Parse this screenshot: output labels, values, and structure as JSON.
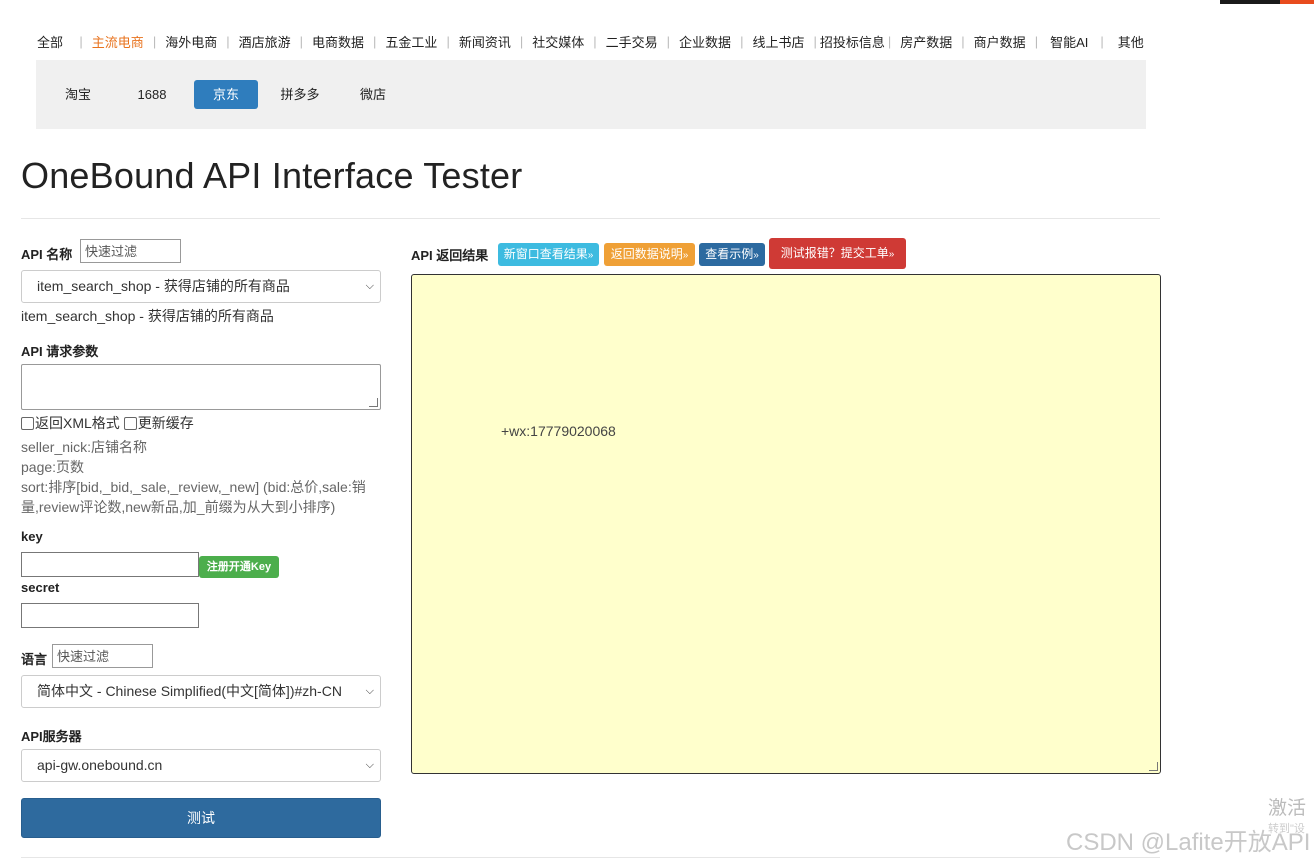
{
  "nav": {
    "items": [
      "全部",
      "主流电商",
      "海外电商",
      "酒店旅游",
      "电商数据",
      "五金工业",
      "新闻资讯",
      "社交媒体",
      "二手交易",
      "企业数据",
      "线上书店",
      "招投标信息",
      "房产数据",
      "商户数据",
      "智能AI",
      "其他"
    ],
    "active": "主流电商"
  },
  "subnav": {
    "items": [
      "淘宝",
      "1688",
      "京东",
      "拼多多",
      "微店"
    ],
    "active": "京东"
  },
  "page_title": "OneBound API Interface Tester",
  "form": {
    "api_name_label": "API 名称",
    "api_filter_placeholder": "快速过滤",
    "api_select_value": "item_search_shop - 获得店铺的所有商品",
    "api_desc": "item_search_shop - 获得店铺的所有商品",
    "params_label": "API 请求参数",
    "xml_check_label": "返回XML格式",
    "cache_check_label": "更新缓存",
    "hint_lines": [
      "seller_nick:店铺名称",
      "page:页数",
      "sort:排序[bid,_bid,_sale,_review,_new] (bid:总价,sale:销",
      "量,review评论数,new新品,加_前缀为从大到小排序)"
    ],
    "key_label": "key",
    "register_button": "注册开通Key",
    "secret_label": "secret",
    "lang_label": "语言",
    "lang_filter_placeholder": "快速过滤",
    "lang_select_value": "简体中文 - Chinese Simplified(中文[简体])#zh-CN",
    "server_label": "API服务器",
    "server_select_value": "api-gw.onebound.cn",
    "test_button": "测试"
  },
  "result": {
    "label": "API 返回结果",
    "buttons": [
      "新窗口查看结果",
      "返回数据说明",
      "查看示例",
      "测试报错？提交工单"
    ],
    "button_arrow": "»",
    "content": "+wx:17779020068"
  },
  "watermark": {
    "activate": "激活",
    "activate_sub": "转到\"设",
    "csdn": "CSDN @Lafite开放API"
  },
  "colors": {
    "active_nav": "#e8731e",
    "subnav_active": "#2f7dbd",
    "btn_info": "#3dbbe0",
    "btn_warning": "#efa036",
    "btn_primary": "#2c6aa0",
    "btn_danger": "#cf3a35",
    "btn_success": "#4cae4c",
    "result_bg": "#ffffcc"
  }
}
